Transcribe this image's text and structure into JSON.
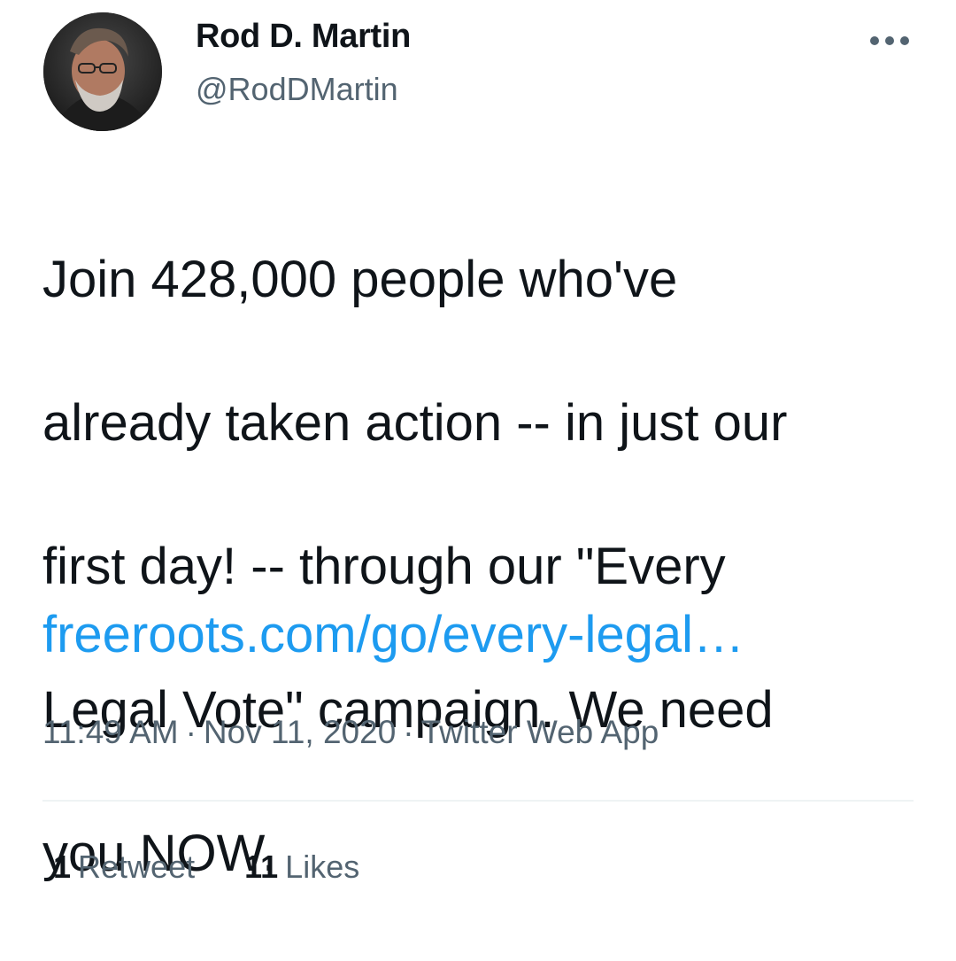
{
  "author": {
    "display_name": "Rod D. Martin",
    "handle": "@RodDMartin"
  },
  "tweet": {
    "text_lines": [
      "Join 428,000 people who've",
      "already taken action -- in just our",
      "first day! -- through our \"Every",
      "Legal Vote\" campaign. We need",
      "you NOW."
    ],
    "link": "freeroots.com/go/every-legal…"
  },
  "meta": {
    "time": "11:49 AM",
    "date": "Nov 11, 2020",
    "source": "Twitter Web App",
    "separator": "·"
  },
  "stats": {
    "retweets_count": "1",
    "retweets_label": "Retweet",
    "likes_count": "11",
    "likes_label": "Likes"
  },
  "icons": {
    "more": "more-horizontal-icon"
  },
  "colors": {
    "link": "#1d9bf0",
    "secondary_text": "#536471",
    "primary_text": "#0f1419",
    "divider": "#eff3f4"
  }
}
